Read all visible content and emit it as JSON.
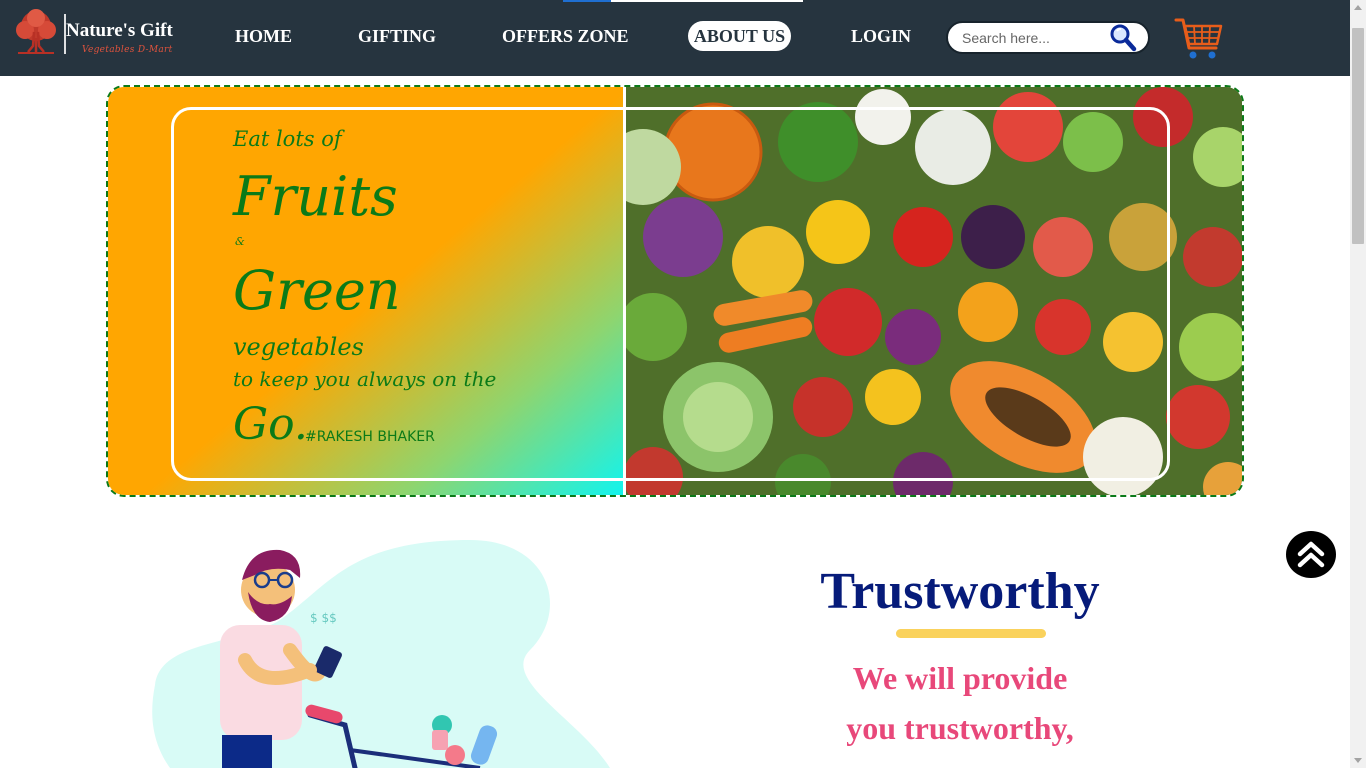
{
  "brand": {
    "name": "Nature's Gift",
    "tagline": "Vegetables D-Mart",
    "accent_color": "#e0533d"
  },
  "nav": {
    "items": [
      {
        "label": "HOME"
      },
      {
        "label": "GIFTING"
      },
      {
        "label": "OFFERS ZONE"
      },
      {
        "label": "ABOUT US",
        "active": true
      },
      {
        "label": "LOGIN"
      }
    ],
    "background": "#26343f",
    "scroll_progress": 0.2
  },
  "search": {
    "placeholder": "Search here...",
    "icon": "search-icon"
  },
  "cart": {
    "icon": "cart-icon"
  },
  "hero": {
    "line_eat": "Eat lots of",
    "line_fruits": "Fruits",
    "line_amp": "&",
    "line_green": "Green",
    "line_veg": "vegetables",
    "line_keep": "to keep you always on the",
    "line_go": "Go.",
    "signature": "#RAKESH BHAKER",
    "text_color": "#0b7a18"
  },
  "trust": {
    "title": "Trustworthy",
    "line1": "We will provide",
    "line2": "you trustworthy,",
    "title_color": "#061b7a",
    "text_color": "#e8487a",
    "underline_color": "#fad25c"
  },
  "back_to_top": {
    "icon": "double-chevron-up-icon"
  }
}
